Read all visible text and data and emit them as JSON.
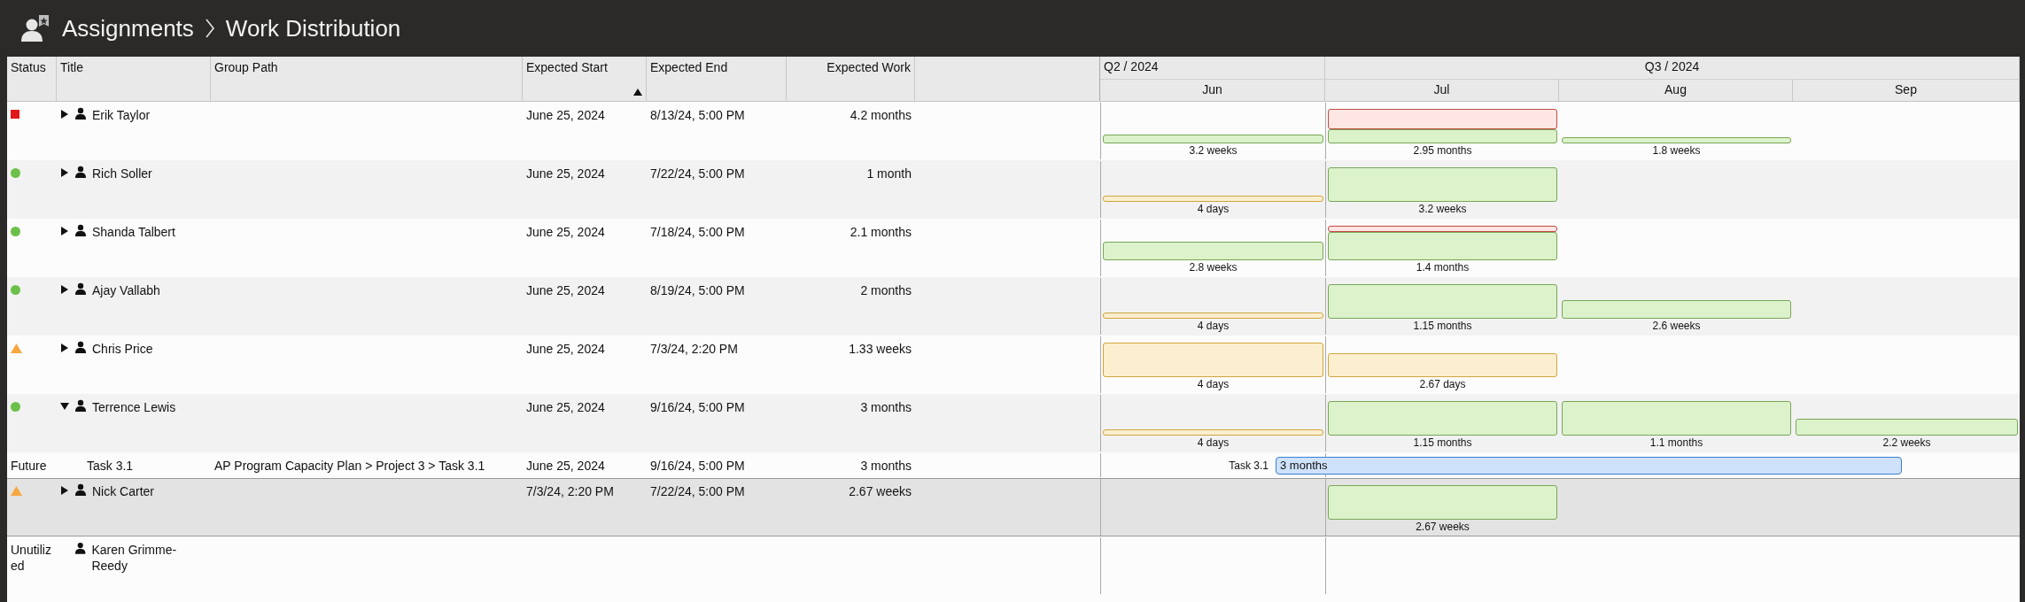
{
  "header": {
    "breadcrumbs": [
      "Assignments",
      "Work Distribution"
    ]
  },
  "columns": [
    {
      "label": "Status",
      "sorted": false
    },
    {
      "label": "Title",
      "sorted": false
    },
    {
      "label": "Group Path",
      "sorted": false
    },
    {
      "label": "Expected Start",
      "sorted": true
    },
    {
      "label": "Expected End",
      "sorted": false
    },
    {
      "label": "Expected Work",
      "sorted": false
    }
  ],
  "timeline": {
    "quarters": [
      {
        "label": "Q2 / 2024",
        "months": [
          "Jun"
        ]
      },
      {
        "label": "Q3 / 2024",
        "months": [
          "Jul",
          "Aug",
          "Sep"
        ]
      }
    ]
  },
  "rows": [
    {
      "kind": "person",
      "selected": false,
      "status": {
        "kind": "square",
        "color": "#e0191b"
      },
      "expanded": false,
      "title": "Erik Taylor",
      "start": "June 25, 2024",
      "end": "8/13/24, 5:00 PM",
      "work": "4.2 months",
      "cells": [
        {
          "kind": "ok",
          "overloaded": false,
          "label": "3.2 weeks"
        },
        {
          "kind": "ok",
          "overloaded": true,
          "label": "2.95 months"
        },
        {
          "kind": "ok",
          "overloaded": false,
          "label": "1.8 weeks"
        },
        {
          "kind": "empty"
        }
      ]
    },
    {
      "kind": "person",
      "selected": false,
      "status": {
        "kind": "dot",
        "color": "#6cc04a"
      },
      "expanded": false,
      "title": "Rich Soller",
      "start": "June 25, 2024",
      "end": "7/22/24, 5:00 PM",
      "work": "1 month",
      "cells": [
        {
          "kind": "under",
          "overloaded": false,
          "label": "4 days"
        },
        {
          "kind": "ok",
          "overloaded": false,
          "label": "3.2 weeks"
        },
        {
          "kind": "empty"
        },
        {
          "kind": "empty"
        }
      ]
    },
    {
      "kind": "person",
      "selected": false,
      "status": {
        "kind": "dot",
        "color": "#6cc04a"
      },
      "expanded": false,
      "title": "Shanda Talbert",
      "start": "June 25, 2024",
      "end": "7/18/24, 5:00 PM",
      "work": "2.1 months",
      "cells": [
        {
          "kind": "ok",
          "overloaded": false,
          "label": "2.8 weeks"
        },
        {
          "kind": "ok",
          "overloaded": true,
          "label": "1.4 months"
        },
        {
          "kind": "empty"
        },
        {
          "kind": "empty"
        }
      ]
    },
    {
      "kind": "person",
      "selected": false,
      "status": {
        "kind": "dot",
        "color": "#6cc04a"
      },
      "expanded": false,
      "title": "Ajay Vallabh",
      "start": "June 25, 2024",
      "end": "8/19/24, 5:00 PM",
      "work": "2 months",
      "cells": [
        {
          "kind": "under",
          "overloaded": false,
          "label": "4 days"
        },
        {
          "kind": "ok",
          "overloaded": false,
          "label": "1.15 months"
        },
        {
          "kind": "ok",
          "overloaded": false,
          "label": "2.6 weeks"
        },
        {
          "kind": "empty"
        }
      ]
    },
    {
      "kind": "person",
      "selected": false,
      "status": {
        "kind": "triangle",
        "color": "#f7a740"
      },
      "expanded": false,
      "title": "Chris Price",
      "start": "June 25, 2024",
      "end": "7/3/24, 2:20 PM",
      "work": "1.33 weeks",
      "cells": [
        {
          "kind": "under",
          "overloaded": false,
          "label": "4 days"
        },
        {
          "kind": "under",
          "overloaded": false,
          "label": "2.67 days"
        },
        {
          "kind": "empty"
        },
        {
          "kind": "empty"
        }
      ]
    },
    {
      "kind": "person",
      "selected": false,
      "status": {
        "kind": "dot",
        "color": "#6cc04a"
      },
      "expanded": true,
      "title": "Terrence Lewis",
      "start": "June 25, 2024",
      "end": "9/16/24, 5:00 PM",
      "work": "3 months",
      "cells": [
        {
          "kind": "under",
          "overloaded": false,
          "label": "4 days"
        },
        {
          "kind": "ok",
          "overloaded": false,
          "label": "1.15 months"
        },
        {
          "kind": "ok",
          "overloaded": false,
          "label": "1.1 months"
        },
        {
          "kind": "ok",
          "overloaded": false,
          "label": "2.2 weeks"
        }
      ]
    },
    {
      "kind": "task",
      "selected": false,
      "status": {
        "kind": "text",
        "text": "Future"
      },
      "title": "Task 3.1",
      "group_path": "AP Program Capacity Plan > Project 3 > Task 3.1",
      "start": "June 25, 2024",
      "end": "9/16/24, 5:00 PM",
      "work": "3 months",
      "bar": {
        "name": "Task 3.1",
        "label": "3 months"
      }
    },
    {
      "kind": "person",
      "selected": true,
      "status": {
        "kind": "triangle",
        "color": "#f7a740"
      },
      "expanded": false,
      "title": "Nick Carter",
      "start": "7/3/24, 2:20 PM",
      "end": "7/22/24, 5:00 PM",
      "work": "2.67 weeks",
      "cells": [
        {
          "kind": "empty"
        },
        {
          "kind": "ok",
          "overloaded": false,
          "label": "2.67 weeks"
        },
        {
          "kind": "empty"
        },
        {
          "kind": "empty"
        }
      ]
    },
    {
      "kind": "person",
      "selected": false,
      "status": {
        "kind": "text",
        "text": "Unutilized"
      },
      "title": "Karen Grimme-Reedy"
    }
  ]
}
